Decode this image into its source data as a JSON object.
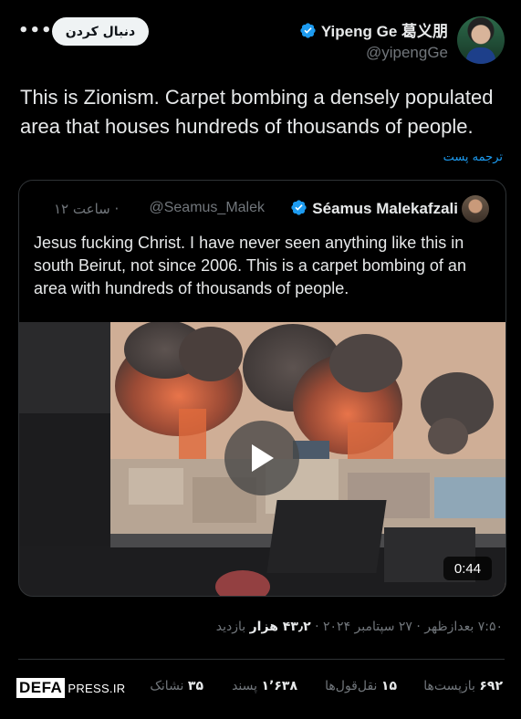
{
  "author": {
    "name": "Yipeng Ge 葛义朋",
    "handle": "@yipengGe",
    "follow_label": "دنبال کردن",
    "more_label": "•••"
  },
  "tweet": {
    "text": "This is Zionism. Carpet bombing a densely populated area that houses hundreds of thousands of people.",
    "translate_label": "ترجمه پست"
  },
  "quote": {
    "name": "Séamus Malekafzali",
    "handle": "@Seamus_Malek",
    "time": "۱۲ ساعت ·",
    "text": "Jesus fucking Christ. I have never seen anything like this in south Beirut, not since 2006. This is a carpet bombing of an area with hundreds of thousands of people.",
    "video_duration": "0:44"
  },
  "meta": {
    "time": "۷:۵۰ بعدازظهر",
    "separator1": " · ",
    "date": "۲۷ سپتامبر ۲۰۲۴",
    "separator2": " · ",
    "views_count": "۴۳٫۲ هزار",
    "views_label": " بازدید"
  },
  "stats": {
    "reposts_count": "۶۹۲",
    "reposts_label": " بازپست‌ها",
    "quotes_count": "۱۵",
    "quotes_label": " نقل‌قول‌ها",
    "likes_count": "۱٬۶۳۸",
    "likes_label": " پسند",
    "bookmarks_count": "۳۵",
    "bookmarks_label": " نشانک"
  },
  "watermark": {
    "box": "DEFA",
    "rest": "PRESS.IR"
  },
  "colors": {
    "background": "#000000",
    "text": "#e7e9ea",
    "secondary": "#71767b",
    "link": "#1d9bf0",
    "verified": "#1d9bf0"
  }
}
